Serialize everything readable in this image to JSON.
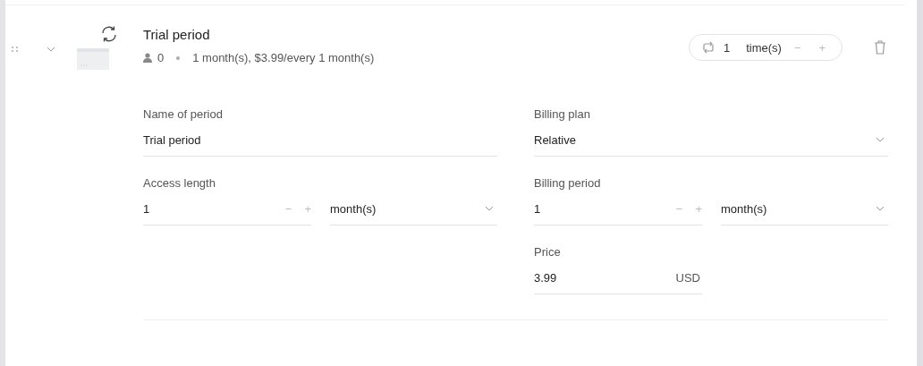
{
  "period": {
    "title": "Trial period",
    "expanded": true,
    "members": "0",
    "summary": "1 month(s), $3.99/every 1 month(s)",
    "repeat": {
      "count": "1",
      "unit": "time(s)",
      "minus": "−",
      "plus": "+"
    }
  },
  "fields": {
    "name": {
      "label": "Name of period",
      "value": "Trial period"
    },
    "billing_plan": {
      "label": "Billing plan",
      "value": "Relative"
    },
    "access_length": {
      "label": "Access length",
      "value": "1",
      "minus": "−",
      "plus": "+",
      "unit": "month(s)"
    },
    "billing_period": {
      "label": "Billing period",
      "value": "1",
      "minus": "−",
      "plus": "+",
      "unit": "month(s)"
    },
    "price": {
      "label": "Price",
      "value": "3.99",
      "currency": "USD"
    }
  }
}
